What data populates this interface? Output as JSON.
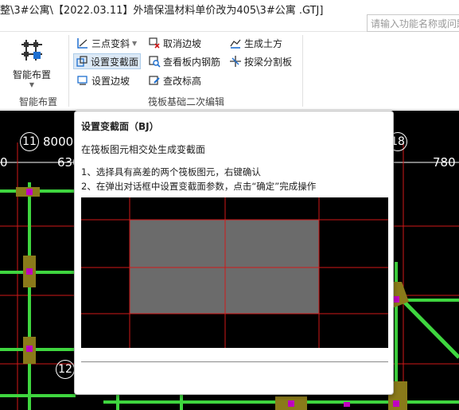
{
  "window": {
    "title": "整\\3#公寓\\【2022.03.11】外墙保温材料单价改为405\\3#公寓 .GTJ]",
    "search_placeholder": "请输入功能名称或问题"
  },
  "ribbon": {
    "smart_layout": {
      "label": "智能布置",
      "group_label": "智能布置"
    },
    "group_label": "筏板基础二次编辑",
    "buttons": {
      "three_point_slope": "三点变斜",
      "set_variable_section": "设置变截面",
      "set_edge_slope": "设置边坡",
      "cancel_edge_slope": "取消边坡",
      "view_slab_rebar": "查看板内钢筋",
      "view_elevation": "查改标高",
      "generate_earthwork": "生成土方",
      "split_by_beam": "按梁分割板"
    }
  },
  "canvas": {
    "axis_labels": [
      "11",
      "12",
      "18"
    ],
    "dimensions": [
      "8000",
      "630",
      "780",
      "0"
    ]
  },
  "tooltip": {
    "title": "设置变截面（BJ）",
    "description": "在筏板图元相交处生成变截面",
    "step1": "1、选择具有高差的两个筏板图元，右键确认",
    "step2": "2、在弹出对话框中设置变截面参数，点击“确定”完成操作"
  },
  "colors": {
    "beam_green": "#3fd63f",
    "column_olive": "#8a7a1a",
    "node_magenta": "#c000c0",
    "grid_red": "#d01818",
    "slab_gray": "#6b6b6b",
    "active_highlight": "#dce9f6"
  }
}
